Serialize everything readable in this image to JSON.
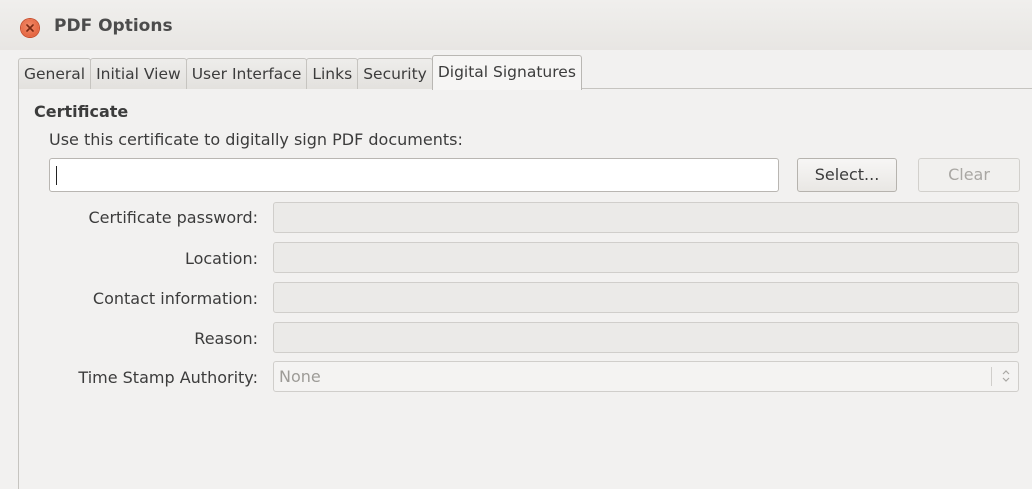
{
  "window": {
    "title": "PDF Options"
  },
  "tabs": [
    {
      "label": "General"
    },
    {
      "label": "Initial View"
    },
    {
      "label": "User Interface"
    },
    {
      "label": "Links"
    },
    {
      "label": "Security"
    },
    {
      "label": "Digital Signatures",
      "active": true
    }
  ],
  "certificate": {
    "section_title": "Certificate",
    "description": "Use this certificate to digitally sign PDF documents:",
    "input_value": "",
    "select_label": "Select...",
    "clear_label": "Clear"
  },
  "fields": {
    "password_label": "Certificate password:",
    "location_label": "Location:",
    "contact_label": "Contact information:",
    "reason_label": "Reason:",
    "tsa_label": "Time Stamp Authority:",
    "tsa_value": "None"
  },
  "icons": {
    "close": "close-icon",
    "spinner": "spinner-arrows-icon"
  },
  "colors": {
    "close_button": "#e0562f",
    "window_bg": "#f2f1f0",
    "disabled_field": "#ebeae8"
  }
}
